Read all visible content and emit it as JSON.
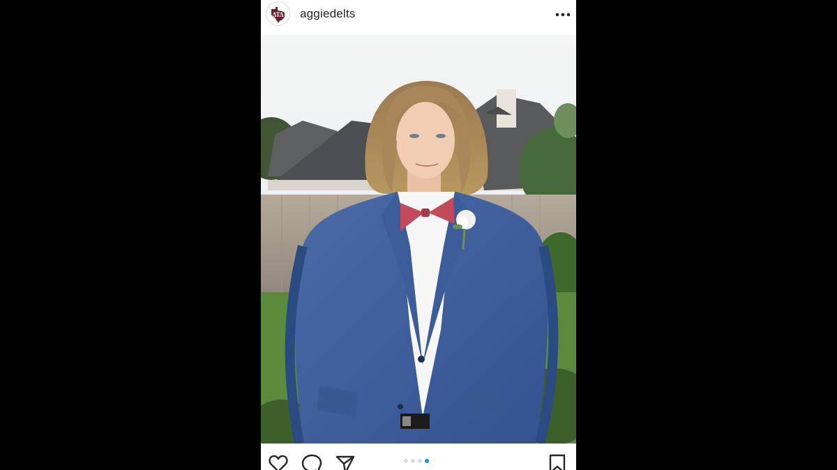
{
  "post": {
    "username": "aggiedelts",
    "avatar_icon": "texas-delta-crest-icon",
    "more_icon": "more-horizontal-icon",
    "photo_description": "",
    "carousel": {
      "total": 4,
      "active_index": 3
    },
    "actions": {
      "like_icon": "heart-icon",
      "comment_icon": "comment-icon",
      "share_icon": "send-icon",
      "save_icon": "bookmark-icon"
    }
  },
  "colors": {
    "accent": "#0095f6",
    "dot_inactive": "#dbdbdb",
    "brand_maroon": "#6b1e2e",
    "text": "#262626"
  }
}
